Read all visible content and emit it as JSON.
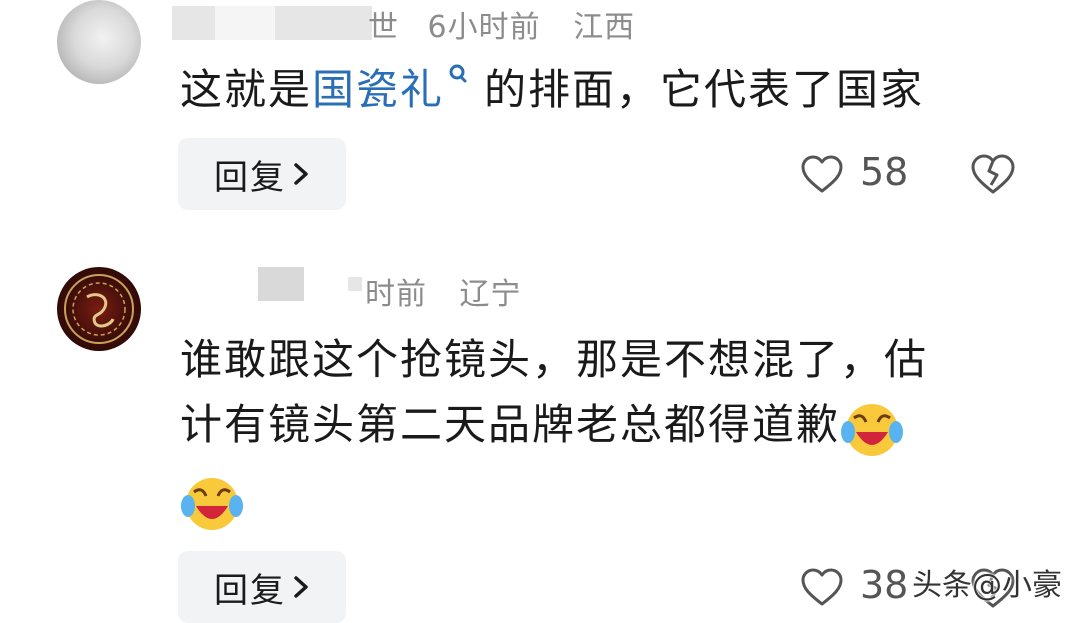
{
  "comments": [
    {
      "meta_time": "6小时前",
      "meta_region": "江西",
      "meta_prefix": "世",
      "text_before": "这就是",
      "link_text": "国瓷礼",
      "text_after": "的排面，它代表了国家",
      "reply_label": "回复",
      "likes": "58"
    },
    {
      "meta_time": "时前",
      "meta_region": "辽宁",
      "line1": "谁敢跟这个抢镜头，那是不想混了，估",
      "line2": "计有镜头第二天品牌老总都得道歉",
      "reply_label": "回复",
      "likes": "38"
    }
  ],
  "watermark": "头条@小豪"
}
